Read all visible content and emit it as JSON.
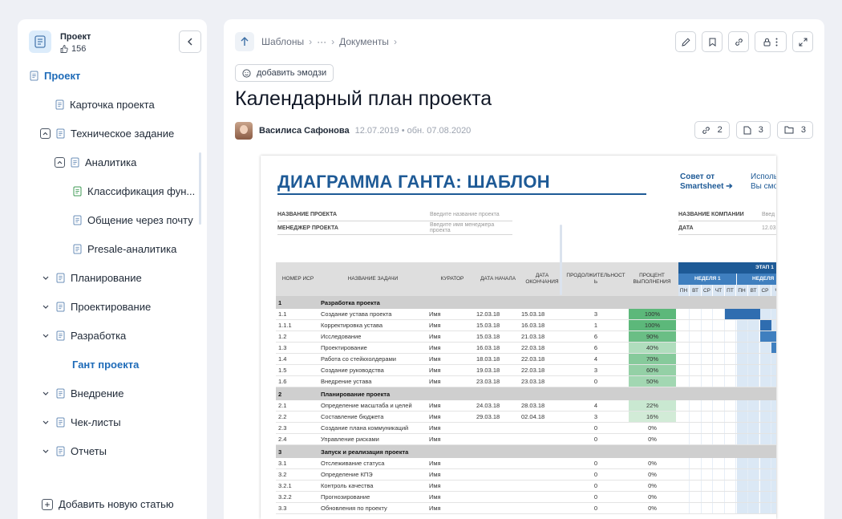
{
  "sidebar": {
    "project_name": "Проект",
    "likes": "156",
    "tree": [
      {
        "label": "Проект",
        "level": 0,
        "kind": "root"
      },
      {
        "label": "Карточка проекта",
        "level": 1,
        "kind": "doc"
      },
      {
        "label": "Техническое задание",
        "level": 1,
        "kind": "expanded"
      },
      {
        "label": "Аналитика",
        "level": 2,
        "kind": "expanded"
      },
      {
        "label": "Классификация фун...",
        "level": 3,
        "kind": "doc-green"
      },
      {
        "label": "Общение через почту",
        "level": 3,
        "kind": "doc"
      },
      {
        "label": "Presale-аналитика",
        "level": 3,
        "kind": "doc"
      },
      {
        "label": "Планирование",
        "level": 1,
        "kind": "collapsed"
      },
      {
        "label": "Проектирование",
        "level": 1,
        "kind": "collapsed"
      },
      {
        "label": "Разработка",
        "level": 1,
        "kind": "collapsed"
      },
      {
        "label": "Гант проекта",
        "level": 2,
        "kind": "active"
      },
      {
        "label": "Внедрение",
        "level": 1,
        "kind": "collapsed"
      },
      {
        "label": "Чек-листы",
        "level": 1,
        "kind": "collapsed"
      },
      {
        "label": "Отчеты",
        "level": 1,
        "kind": "collapsed"
      }
    ],
    "add_label": "Добавить новую статью"
  },
  "breadcrumbs": [
    "Шаблоны",
    "···",
    "Документы"
  ],
  "emoji_label": "добавить эмодзи",
  "title": "Календарный план проекта",
  "author": {
    "name": "Василиса Сафонова",
    "date": "12.07.2019 • обн. 07.08.2020"
  },
  "counters": {
    "links": "2",
    "pages": "3",
    "folders": "3"
  },
  "gantt": {
    "title": "ДИАГРАММА ГАНТА: ШАБЛОН",
    "smartsheet_line1": "Совет от",
    "smartsheet_line2": "Smartsheet ➔",
    "use_line1": "Исполь",
    "use_line2": "Вы смо",
    "meta": [
      {
        "label": "НАЗВАНИЕ ПРОЕКТА",
        "value": "Введите название проекта"
      },
      {
        "label": "МЕНЕДЖЕР ПРОЕКТА",
        "value": "Введите имя менеджера проекта"
      }
    ],
    "meta_right": [
      {
        "label": "НАЗВАНИЕ КОМПАНИИ",
        "value": "Введ"
      },
      {
        "label": "ДАТА",
        "value": "12.03"
      }
    ],
    "headers": {
      "wbs": "НОМЕР ИСР",
      "task": "НАЗВАНИЕ ЗАДАЧИ",
      "owner": "КУРАТОР",
      "start": "ДАТА НАЧАЛА",
      "end": "ДАТА ОКОНЧАНИЯ",
      "duration": "ПРОДОЛЖИТЕЛЬНОСТЬ",
      "percent": "ПРОЦЕНТ ВЫПОЛНЕНИЯ",
      "stage": "ЭТАП 1",
      "week1": "НЕДЕЛЯ 1",
      "week2": "НЕДЕЛЯ",
      "days": [
        "ПН",
        "ВТ",
        "СР",
        "ЧТ",
        "ПТ",
        "ПН",
        "ВТ",
        "СР",
        "Ч"
      ]
    },
    "rows": [
      {
        "type": "phase",
        "wbs": "1",
        "task": "Разработка проекта"
      },
      {
        "type": "task",
        "wbs": "1.1",
        "task": "Создание устава проекта",
        "owner": "Имя",
        "start": "12.03.18",
        "end": "15.03.18",
        "duration": "3",
        "percent": "100%",
        "pct": 100,
        "bar": [
          4,
          7
        ]
      },
      {
        "type": "task",
        "wbs": "1.1.1",
        "task": "Корректировка устава",
        "owner": "Имя",
        "start": "15.03.18",
        "end": "16.03.18",
        "duration": "1",
        "percent": "100%",
        "pct": 100,
        "bar": [
          7,
          8
        ]
      },
      {
        "type": "task",
        "wbs": "1.2",
        "task": "Исследование",
        "owner": "Имя",
        "start": "15.03.18",
        "end": "21.03.18",
        "duration": "6",
        "percent": "90%",
        "pct": 90,
        "bar": [
          7,
          10
        ]
      },
      {
        "type": "task",
        "wbs": "1.3",
        "task": "Проектирование",
        "owner": "Имя",
        "start": "16.03.18",
        "end": "22.03.18",
        "duration": "6",
        "percent": "40%",
        "pct": 40,
        "bar": [
          8,
          10
        ]
      },
      {
        "type": "task",
        "wbs": "1.4",
        "task": "Работа со стейкхолдерами",
        "owner": "Имя",
        "start": "18.03.18",
        "end": "22.03.18",
        "duration": "4",
        "percent": "70%",
        "pct": 70,
        "bar": [
          9,
          10
        ]
      },
      {
        "type": "task",
        "wbs": "1.5",
        "task": "Создание руководства",
        "owner": "Имя",
        "start": "19.03.18",
        "end": "22.03.18",
        "duration": "3",
        "percent": "60%",
        "pct": 60,
        "bar": [
          9,
          10
        ]
      },
      {
        "type": "task",
        "wbs": "1.6",
        "task": "Внедрение устава",
        "owner": "Имя",
        "start": "23.03.18",
        "end": "23.03.18",
        "duration": "0",
        "percent": "50%",
        "pct": 50,
        "bar": null
      },
      {
        "type": "phase",
        "wbs": "2",
        "task": "Планирование проекта"
      },
      {
        "type": "task",
        "wbs": "2.1",
        "task": "Определение масштаба и целей",
        "owner": "Имя",
        "start": "24.03.18",
        "end": "28.03.18",
        "duration": "4",
        "percent": "22%",
        "pct": 22,
        "bar": null
      },
      {
        "type": "task",
        "wbs": "2.2",
        "task": "Составление бюджета",
        "owner": "Имя",
        "start": "29.03.18",
        "end": "02.04.18",
        "duration": "3",
        "percent": "16%",
        "pct": 16,
        "bar": null
      },
      {
        "type": "task",
        "wbs": "2.3",
        "task": "Создание плана коммуникаций",
        "owner": "Имя",
        "start": "",
        "end": "",
        "duration": "0",
        "percent": "0%",
        "pct": 0,
        "bar": null
      },
      {
        "type": "task",
        "wbs": "2.4",
        "task": "Управление рисками",
        "owner": "Имя",
        "start": "",
        "end": "",
        "duration": "0",
        "percent": "0%",
        "pct": 0,
        "bar": null
      },
      {
        "type": "phase",
        "wbs": "3",
        "task": "Запуск и реализация проекта"
      },
      {
        "type": "task",
        "wbs": "3.1",
        "task": "Отслеживание статуса",
        "owner": "Имя",
        "start": "",
        "end": "",
        "duration": "0",
        "percent": "0%",
        "pct": 0,
        "bar": null
      },
      {
        "type": "task",
        "wbs": "3.2",
        "task": "Определение КПЭ",
        "owner": "Имя",
        "start": "",
        "end": "",
        "duration": "0",
        "percent": "0%",
        "pct": 0,
        "bar": null
      },
      {
        "type": "task",
        "wbs": "3.2.1",
        "task": "Контроль качества",
        "owner": "Имя",
        "start": "",
        "end": "",
        "duration": "0",
        "percent": "0%",
        "pct": 0,
        "bar": null
      },
      {
        "type": "task",
        "wbs": "3.2.2",
        "task": "Прогнозирование",
        "owner": "Имя",
        "start": "",
        "end": "",
        "duration": "0",
        "percent": "0%",
        "pct": 0,
        "bar": null
      },
      {
        "type": "task",
        "wbs": "3.3",
        "task": "Обновления по проекту",
        "owner": "Имя",
        "start": "",
        "end": "",
        "duration": "0",
        "percent": "0%",
        "pct": 0,
        "bar": null
      }
    ]
  },
  "colors": {
    "accent": "#1e6bb8",
    "gantt_blue": "#1e5a96",
    "done_green": "#5cb87a"
  }
}
